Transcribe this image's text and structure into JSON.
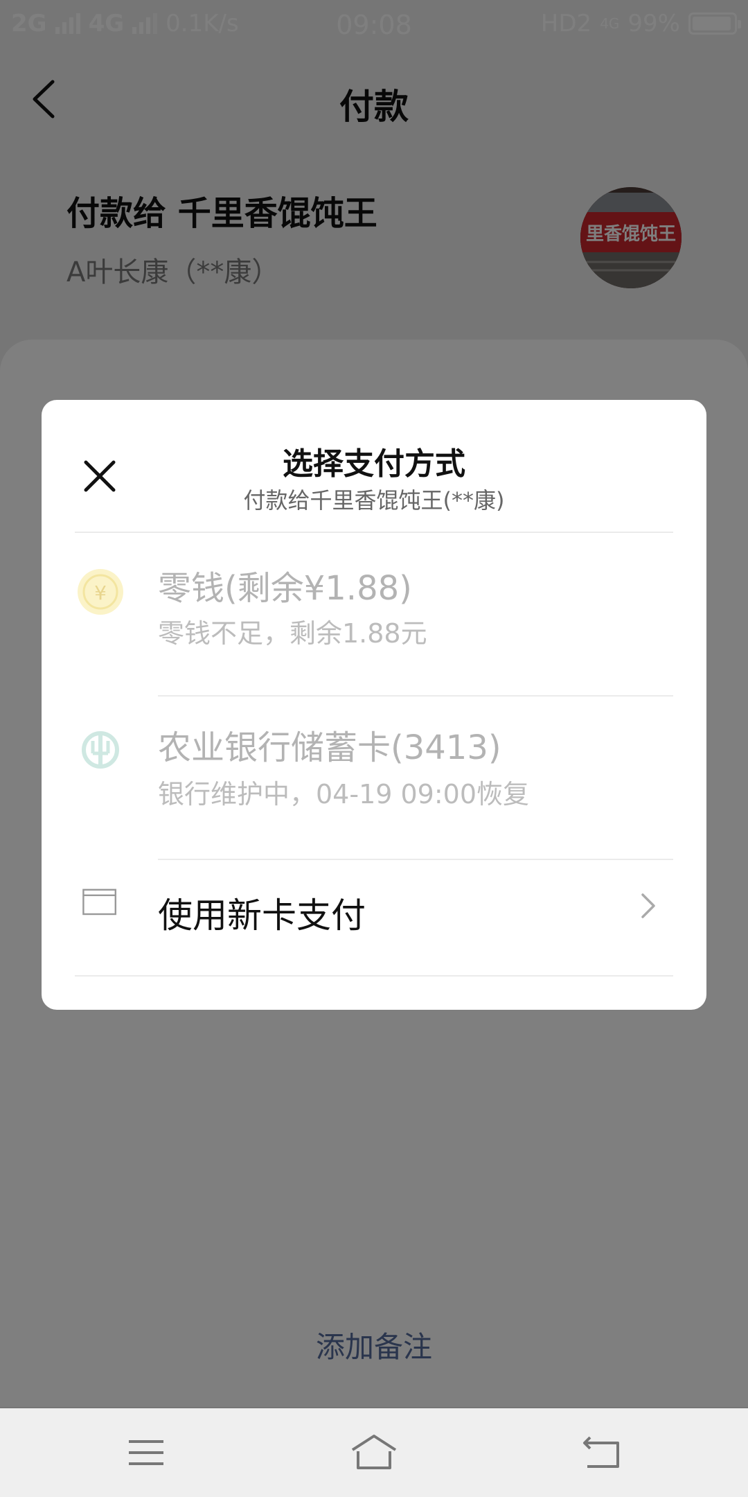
{
  "status_bar": {
    "net1": "2G",
    "net2": "4G",
    "speed": "0.1K/s",
    "time": "09:08",
    "hd": "HD2",
    "net_small": "4G",
    "battery": "99%"
  },
  "header": {
    "title": "付款"
  },
  "payee": {
    "line1": "付款给 千里香馄饨王",
    "line2": "A叶长康（**康）",
    "avatar_sign_text": "里香馄饨王"
  },
  "modal": {
    "title": "选择支付方式",
    "subtitle": "付款给千里香馄饨王(**康)",
    "options": [
      {
        "icon": "coin-icon",
        "name": "零钱(剩余¥1.88)",
        "desc": "零钱不足，剩余1.88元",
        "enabled": false
      },
      {
        "icon": "abc-bank-icon",
        "name": "农业银行储蓄卡(3413)",
        "desc": "银行维护中，04-19 09:00恢复",
        "enabled": false
      }
    ],
    "new_card": {
      "icon": "card-icon",
      "label": "使用新卡支付"
    }
  },
  "sheet": {
    "add_note": "添加备注"
  },
  "colors": {
    "overlay": "rgba(0,0,0,0.5)",
    "link": "#556a9a",
    "disabled_text": "#b3b3b3"
  }
}
